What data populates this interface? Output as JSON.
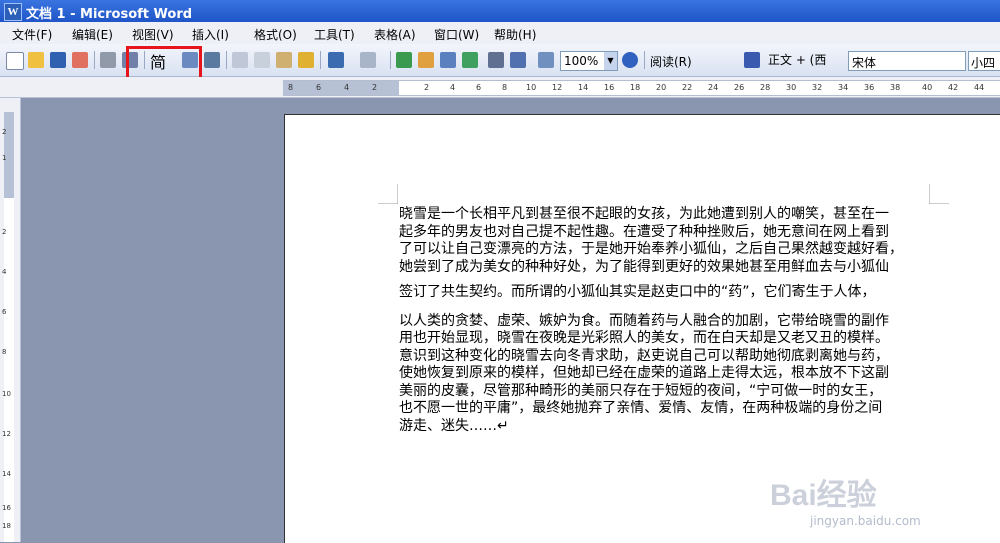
{
  "window": {
    "title": "文档 1 - Microsoft Word"
  },
  "menu": [
    "文件(F)",
    "编辑(E)",
    "视图(V)",
    "插入(I)",
    "格式(O)",
    "工具(T)",
    "表格(A)",
    "窗口(W)",
    "帮助(H)"
  ],
  "toolbar": {
    "simplified_label": "简",
    "zoom_value": "100%",
    "read_label": "阅读(R)",
    "style_value": "正文 + (西",
    "font_value": "宋体",
    "size_value": "小四"
  },
  "icons": [
    "new-document-icon",
    "open-folder-icon",
    "save-icon",
    "permission-icon",
    "print-icon",
    "print-preview-icon",
    "simplified-traditional-icon",
    "spelling-icon",
    "research-icon",
    "cut-icon",
    "copy-icon",
    "paste-icon",
    "format-painter-icon",
    "undo-icon",
    "redo-icon",
    "hyperlink-icon",
    "tables-borders-icon",
    "insert-table-icon",
    "insert-excel-icon",
    "columns-icon",
    "drawing-icon",
    "document-map-icon",
    "help-icon",
    "styles-icon"
  ],
  "ruler": {
    "horizontal_ticks": [
      "8",
      "6",
      "4",
      "2",
      "2",
      "4",
      "6",
      "8",
      "10",
      "12",
      "14",
      "16",
      "18",
      "20",
      "22",
      "24",
      "26",
      "28",
      "30",
      "32",
      "34",
      "36",
      "38",
      "40",
      "42",
      "44"
    ],
    "vertical_ticks": [
      "2",
      "1",
      "2",
      "4",
      "6",
      "8",
      "10",
      "12",
      "14",
      "16",
      "18"
    ]
  },
  "document": {
    "para1": [
      "晓雪是一个长相平凡到甚至很不起眼的女孩，为此她遭到别人的嘲笑，甚至在一",
      "起多年的男友也对自己提不起性趣。在遭受了种种挫败后，她无意间在网上看到",
      "了可以让自己变漂亮的方法，于是她开始奉养小狐仙，之后自己果然越变越好看，",
      "她尝到了成为美女的种种好处，为了能得到更好的效果她甚至用鲜血去与小狐仙"
    ],
    "para2": [
      "签订了共生契约。而所谓的小狐仙其实是赵吏口中的“药”，它们寄生于人体，"
    ],
    "para3": [
      "以人类的贪婪、虚荣、嫉妒为食。而随着药与人融合的加剧，它带给晓雪的副作",
      "用也开始显现，晓雪在夜晚是光彩照人的美女，而在白天却是又老又丑的模样。",
      "意识到这种变化的晓雪去向冬青求助，赵吏说自己可以帮助她彻底剥离她与药，",
      "使她恢复到原来的模样，但她却已经在虚荣的道路上走得太远，根本放不下这副",
      "美丽的皮囊，尽管那种畸形的美丽只存在于短短的夜间，“宁可做一时的女王，",
      "也不愿一世的平庸”，最终她抛弃了亲情、爱情、友情，在两种极端的身份之间",
      "游走、迷失……↵"
    ]
  },
  "watermark": {
    "brand": "Bai经验",
    "url": "jingyan.baidu.com"
  },
  "colors": {
    "title_bar": "#1f55c8",
    "highlight_box": "#e8141c",
    "workspace": "#8a96b0"
  }
}
